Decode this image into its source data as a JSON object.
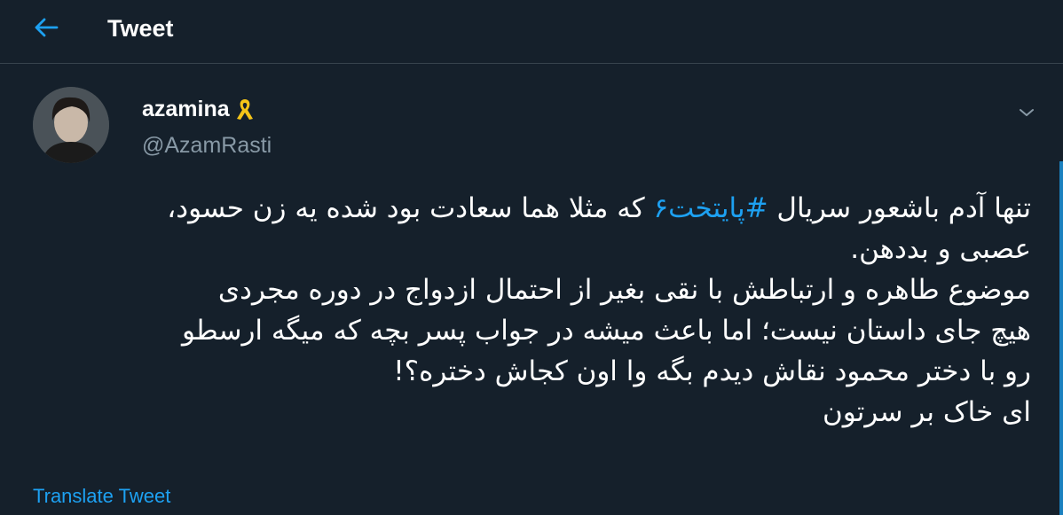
{
  "header": {
    "title": "Tweet",
    "back_icon": "arrow-left-icon"
  },
  "author": {
    "display_name": "azamina",
    "badge_icon": "yellow-ribbon-icon",
    "handle": "@AzamRasti"
  },
  "tweet": {
    "lines": [
      {
        "before": "تنها آدم باشعور سریال ",
        "hashtag": "#پایتخت۶",
        "after": " که مثلا هما سعادت بود شده یه زن حسود،"
      },
      {
        "text": "عصبی و بددهن."
      },
      {
        "text": "موضوع طاهره و ارتباطش با نقی بغیر از احتمال ازدواج در دوره مجردی"
      },
      {
        "text": "هیچ جای داستان نیست؛ اما باعث میشه در جواب پسر بچه که میگه ارسطو"
      },
      {
        "text": "رو با دختر محمود نقاش دیدم بگه وا اون کجاش دختره؟!"
      },
      {
        "text": "ای خاک بر سرتون"
      }
    ]
  },
  "translate_label": "Translate Tweet",
  "colors": {
    "background": "#15202b",
    "accent": "#1da1f2",
    "secondary_text": "#8899a6",
    "ribbon": "#f5c518"
  }
}
